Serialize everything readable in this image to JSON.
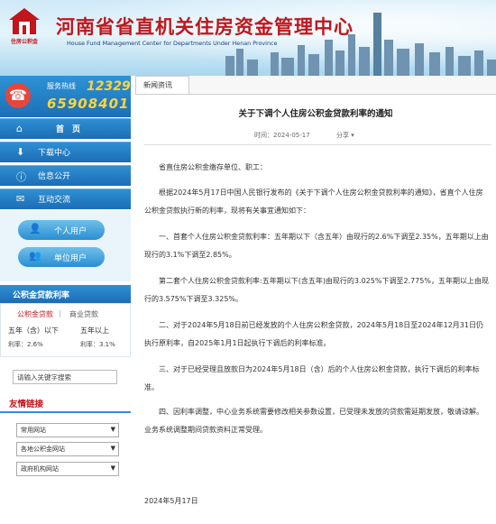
{
  "header": {
    "title": "河南省省直机关住房资金管理中心",
    "subtitle": "House Fund Management Center for Departments Under Henan Province",
    "logo_text": "住房公积金"
  },
  "hotline": {
    "label": "服务热线",
    "short": "12329",
    "long": "65908401"
  },
  "nav": [
    {
      "label": "首　页",
      "icon": "home-icon"
    },
    {
      "label": "下载中心",
      "icon": "download-icon"
    },
    {
      "label": "信息公开",
      "icon": "info-icon"
    },
    {
      "label": "互动交流",
      "icon": "chat-icon"
    }
  ],
  "user_buttons": [
    {
      "label": "个人用户",
      "icon": "person-icon"
    },
    {
      "label": "单位用户",
      "icon": "group-icon"
    }
  ],
  "rates": {
    "title": "公积金贷款利率",
    "tabs": [
      "公积金贷款",
      "商业贷款"
    ],
    "rows": [
      {
        "label": "五年（含）以下",
        "value": "利率：2.6%"
      },
      {
        "label": "五年以上",
        "value": "利率：3.1%"
      }
    ]
  },
  "search": {
    "placeholder": "请输入关键字搜索"
  },
  "links": {
    "title": "友情链接",
    "selects": [
      "常用网站",
      "各地公积金网站",
      "政府机构网站"
    ]
  },
  "news_tab": "新闻资讯",
  "article": {
    "title": "关于下调个人住房公积金贷款利率的通知",
    "time": "时间：2024-05-17",
    "share": "分享",
    "paragraphs": [
      "省直住房公积金缴存单位、职工：",
      "根据2024年5月17日中国人民银行发布的《关于下调个人住房公积金贷款利率的通知》，省直个人住房公积金贷款执行新的利率，现将有关事宜通知如下：",
      "一、首套个人住房公积金贷款利率：五年期以下（含五年）由现行的2.6%下调至2.35%，五年期以上由现行的3.1%下调至2.85%。",
      "第二套个人住房公积金贷款利率:五年期以下(含五年)由现行的3.025%下调至2.775%，五年期以上由现行的3.575%下调至3.325%。",
      "二、对于2024年5月18日前已经发放的个人住房公积金贷款，2024年5月18日至2024年12月31日仍执行原利率，自2025年1月1日起执行下调后的利率标准。",
      "三、对于已经受理且放款日为2024年5月18日（含）后的个人住房公积金贷款，执行下调后的利率标准。",
      "四、因利率调整，中心业务系统需要修改相关参数设置，已受理未发放的贷款需延期发放，敬请谅解。业务系统调整期间贷款资料正常受理。"
    ],
    "signature": "2024年5月17日"
  },
  "colors": {
    "brand_red": "#c0161c",
    "nav_blue": "#1c6db5",
    "hotline_yellow": "#ffd43b"
  }
}
